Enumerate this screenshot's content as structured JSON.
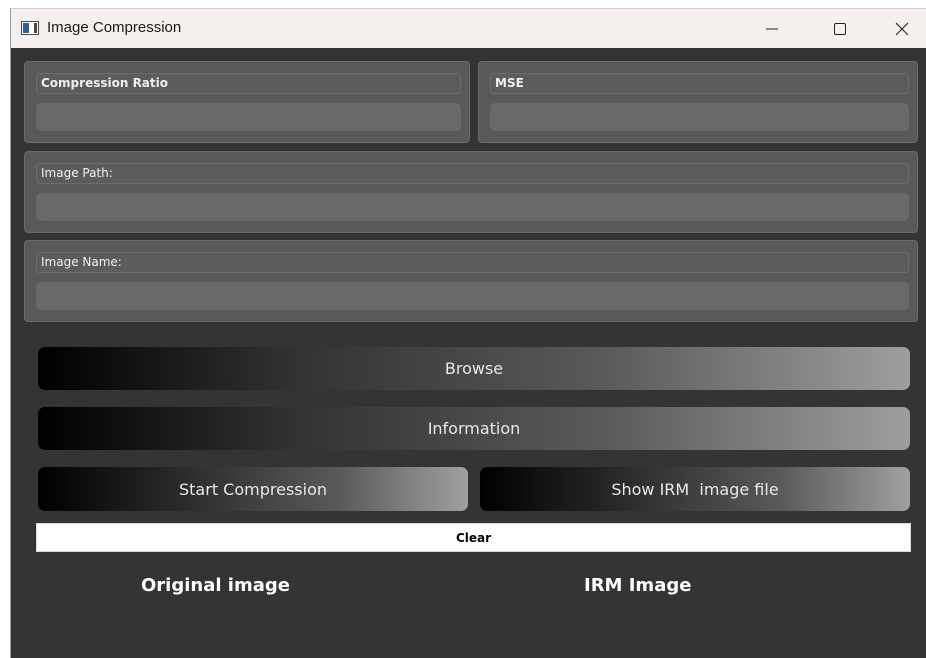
{
  "window": {
    "title": "Image Compression",
    "icon": "app-window-icon",
    "controls": {
      "minimize": "minimize-icon",
      "maximize": "maximize-icon",
      "close": "close-icon"
    }
  },
  "fields": {
    "compression_ratio": {
      "label": "Compression Ratio",
      "value": ""
    },
    "mse": {
      "label": "MSE",
      "value": ""
    },
    "image_path": {
      "label": "Image Path:",
      "value": ""
    },
    "image_name": {
      "label": "Image Name:",
      "value": ""
    }
  },
  "buttons": {
    "browse": "Browse",
    "information": "Information",
    "start_compression": "Start Compression",
    "show_irm": "Show IRM  image file",
    "clear": "Clear"
  },
  "images": {
    "original_label": "Original image",
    "irm_label": "IRM Image"
  },
  "colors": {
    "background": "#343434",
    "panel": "#595959",
    "titlebar": "#f5f0ee"
  }
}
